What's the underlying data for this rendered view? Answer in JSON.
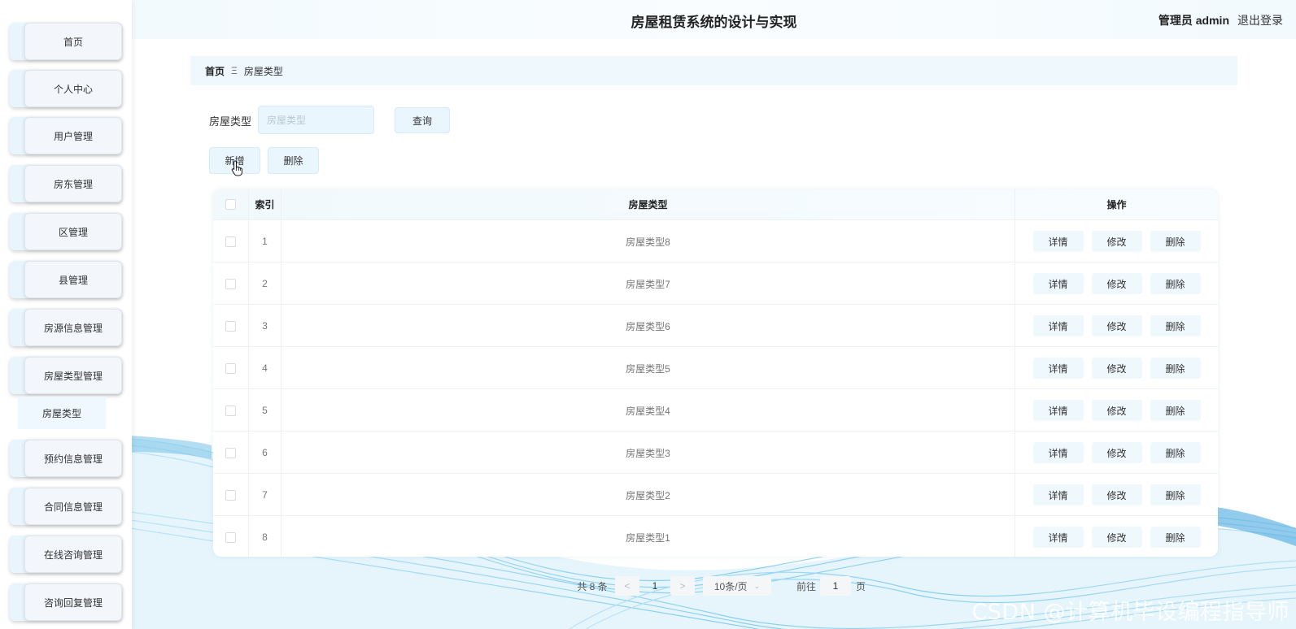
{
  "header": {
    "title": "房屋租赁系统的设计与实现",
    "user": "管理员 admin",
    "logout": "退出登录"
  },
  "sidebar": {
    "items": [
      {
        "label": "首页"
      },
      {
        "label": "个人中心"
      },
      {
        "label": "用户管理"
      },
      {
        "label": "房东管理"
      },
      {
        "label": "区管理"
      },
      {
        "label": "县管理"
      },
      {
        "label": "房源信息管理"
      },
      {
        "label": "房屋类型管理"
      },
      {
        "label": "预约信息管理"
      },
      {
        "label": "合同信息管理"
      },
      {
        "label": "在线咨询管理"
      },
      {
        "label": "咨询回复管理"
      }
    ],
    "submenu": {
      "label": "房屋类型"
    }
  },
  "breadcrumb": {
    "home": "首页",
    "separator": "Ξ",
    "current": "房屋类型"
  },
  "search": {
    "label": "房屋类型",
    "placeholder": "房屋类型",
    "query_button": "查询"
  },
  "actions": {
    "add": "新增",
    "delete": "删除"
  },
  "table": {
    "columns": {
      "index": "索引",
      "type": "房屋类型",
      "ops": "操作"
    },
    "rows": [
      {
        "index": "1",
        "type": "房屋类型8"
      },
      {
        "index": "2",
        "type": "房屋类型7"
      },
      {
        "index": "3",
        "type": "房屋类型6"
      },
      {
        "index": "4",
        "type": "房屋类型5"
      },
      {
        "index": "5",
        "type": "房屋类型4"
      },
      {
        "index": "6",
        "type": "房屋类型3"
      },
      {
        "index": "7",
        "type": "房屋类型2"
      },
      {
        "index": "8",
        "type": "房屋类型1"
      }
    ],
    "row_buttons": {
      "detail": "详情",
      "edit": "修改",
      "delete": "删除"
    }
  },
  "pagination": {
    "total": "共 8 条",
    "prev": "<",
    "current_page": "1",
    "next": ">",
    "page_size": "10条/页",
    "goto_label": "前往",
    "goto_value": "1",
    "page_unit": "页"
  },
  "watermark": "CSDN @计算机毕设编程指导师",
  "colors": {
    "accent": "#eaf6fd",
    "wave": "#4ab3e6"
  }
}
